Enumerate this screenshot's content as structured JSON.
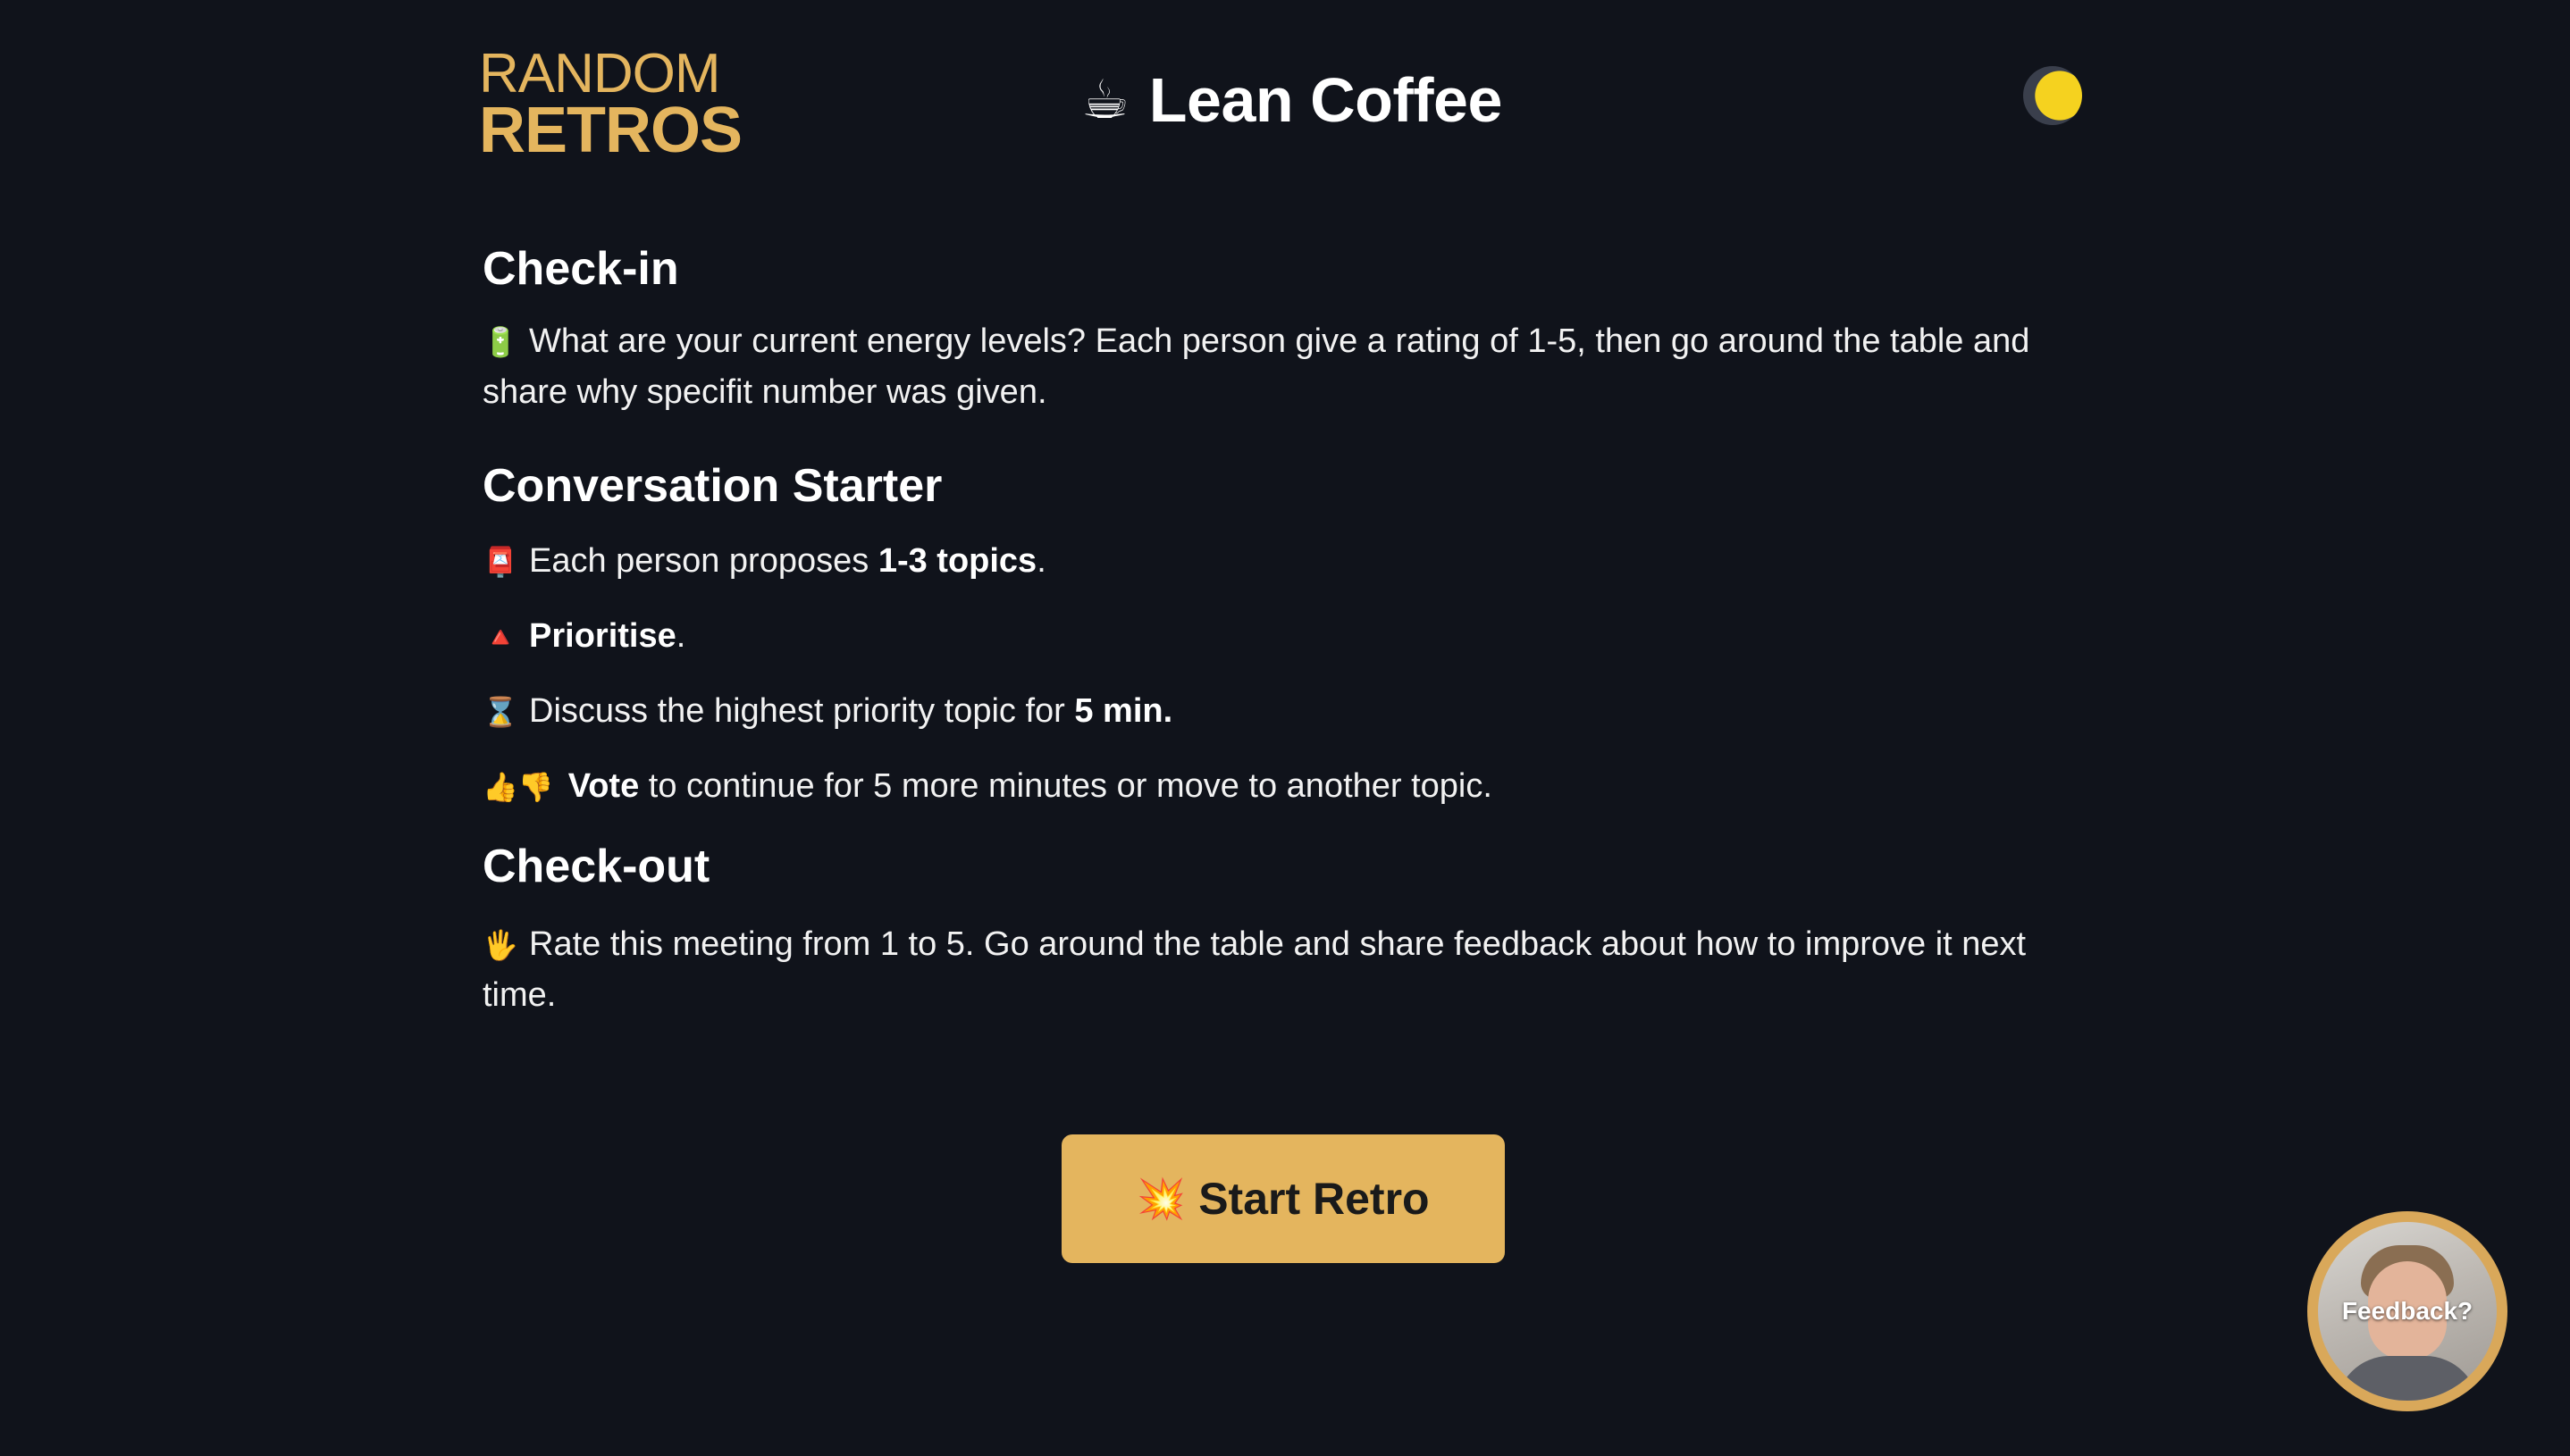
{
  "header": {
    "logo_line1": "RANDOM",
    "logo_line2": "RETROS",
    "title_emoji": "☕",
    "title": "Lean Coffee",
    "theme_icon": "moon-icon"
  },
  "sections": {
    "checkin": {
      "heading": "Check-in",
      "icon": "🔋",
      "text": "What are your current energy levels? Each person give a rating of 1-5, then go around the table and share why specifit number was given."
    },
    "conversation": {
      "heading": "Conversation Starter",
      "items": [
        {
          "icon": "📮",
          "before": "Each person proposes ",
          "bold": "1-3 topics",
          "after": "."
        },
        {
          "icon": "🔺",
          "before": "",
          "bold": "Prioritise",
          "after": "."
        },
        {
          "icon": "⌛",
          "before": "Discuss the highest priority topic for ",
          "bold": "5 min.",
          "after": ""
        },
        {
          "icon": "👍👎",
          "before": "",
          "bold": "Vote",
          "after": " to continue for 5 more minutes or move to another topic."
        }
      ]
    },
    "checkout": {
      "heading": "Check-out",
      "icon": "🖐",
      "text": "Rate this meeting from 1 to 5. Go around the table and share feedback about how to improve it next time."
    }
  },
  "start_button": {
    "emoji": "💥",
    "label": "Start Retro"
  },
  "feedback": {
    "label": "Feedback?"
  },
  "colors": {
    "background": "#10131b",
    "accent": "#e4b55e",
    "moon": "#f5d21f"
  }
}
